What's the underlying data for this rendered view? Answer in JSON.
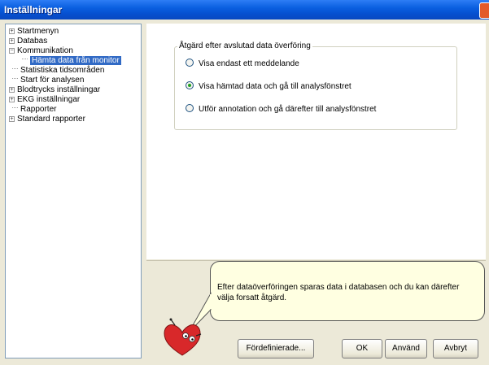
{
  "window": {
    "title": "Inställningar"
  },
  "tree": {
    "items": [
      {
        "label": "Startmenyn",
        "expander": "+"
      },
      {
        "label": "Databas",
        "expander": "+"
      },
      {
        "label": "Kommunikation",
        "expander": "−"
      },
      {
        "label": "Hämta data från monitor",
        "expander": "",
        "selected": true
      },
      {
        "label": "Statistiska tidsområden",
        "expander": ""
      },
      {
        "label": "Start för analysen",
        "expander": ""
      },
      {
        "label": "Blodtrycks inställningar",
        "expander": "+"
      },
      {
        "label": "EKG inställningar",
        "expander": "+"
      },
      {
        "label": "Rapporter",
        "expander": ""
      },
      {
        "label": "Standard rapporter",
        "expander": "+"
      }
    ]
  },
  "group": {
    "legend": "Åtgärd efter avslutad data överföring",
    "options": [
      {
        "label": "Visa endast ett meddelande",
        "checked": false
      },
      {
        "label": "Visa hämtad data och gå till analysfönstret",
        "checked": true
      },
      {
        "label": "Utför annotation och gå därefter till analysfönstret",
        "checked": false
      }
    ]
  },
  "help": {
    "text": "Efter dataöverföringen sparas data i databasen och du kan därefter välja forsatt åtgärd."
  },
  "buttons": {
    "predefined": "Fördefinierade...",
    "ok": "OK",
    "apply": "Använd",
    "cancel": "Avbryt"
  },
  "colors": {
    "titlebar": "#0a5fe0",
    "selection": "#316ac5",
    "bubble": "#ffffe1",
    "mascot": "#d8282a"
  }
}
